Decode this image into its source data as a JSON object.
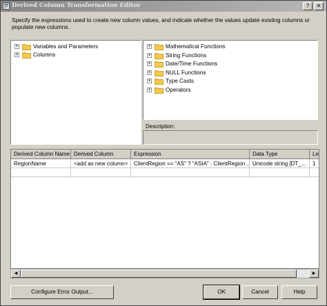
{
  "window": {
    "title": "Derived Column Transformation Editor"
  },
  "titlebar_buttons": {
    "help": "?",
    "close": "✕"
  },
  "description": "Specify the expressions used to create new column values, and indicate whether the values update existing columns or populate new columns.",
  "left_tree": [
    {
      "label": "Variables and Parameters"
    },
    {
      "label": "Columns"
    }
  ],
  "right_tree": [
    {
      "label": "Mathematical Functions"
    },
    {
      "label": "String Functions"
    },
    {
      "label": "Date/Time Functions"
    },
    {
      "label": "NULL Functions"
    },
    {
      "label": "Type Casts"
    },
    {
      "label": "Operators"
    }
  ],
  "description_label": "Description:",
  "grid": {
    "headers": [
      "Derived Column Name",
      "Derived Column",
      "Expression",
      "Data Type",
      "Le"
    ],
    "row": [
      "RegionName",
      "<add as new column>",
      "ClientRegion == \"AS\" ? \"ASIA\" : ClientRegion ...",
      "Unicode string [DT_...",
      "1"
    ]
  },
  "buttons": {
    "error_output": "Configure Error Output...",
    "ok": "OK",
    "cancel": "Cancel",
    "help": "Help"
  },
  "tree_expander": "+",
  "scroll_left": "◀",
  "scroll_right": "▶",
  "colors": {
    "folder": "#f2c94c",
    "folder_edge": "#c9a12e"
  }
}
